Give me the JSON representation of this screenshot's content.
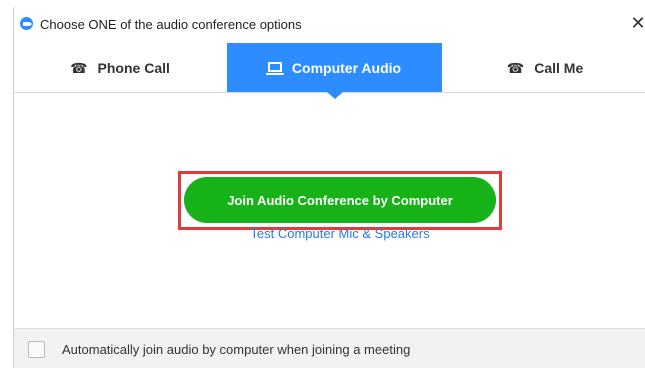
{
  "dialog": {
    "title": "Choose ONE of the audio conference options",
    "close_glyph": "✕"
  },
  "tabs": [
    {
      "label": "Phone Call",
      "icon": "phone-icon",
      "glyph": "☎",
      "selected": false
    },
    {
      "label": "Computer Audio",
      "icon": "monitor-icon",
      "selected": true
    },
    {
      "label": "Call Me",
      "icon": "phone-icon",
      "glyph": "☎",
      "selected": false
    }
  ],
  "main": {
    "join_button_label": "Join Audio Conference by Computer",
    "test_link_label": "Test Computer Mic & Speakers"
  },
  "footer": {
    "auto_join_label": "Automatically join audio by computer when joining a meeting",
    "auto_join_checked": false
  },
  "colors": {
    "accent": "#2d8cff",
    "join_button": "#17b217",
    "highlight": "#e03c3c",
    "link": "#2a7ad9"
  }
}
